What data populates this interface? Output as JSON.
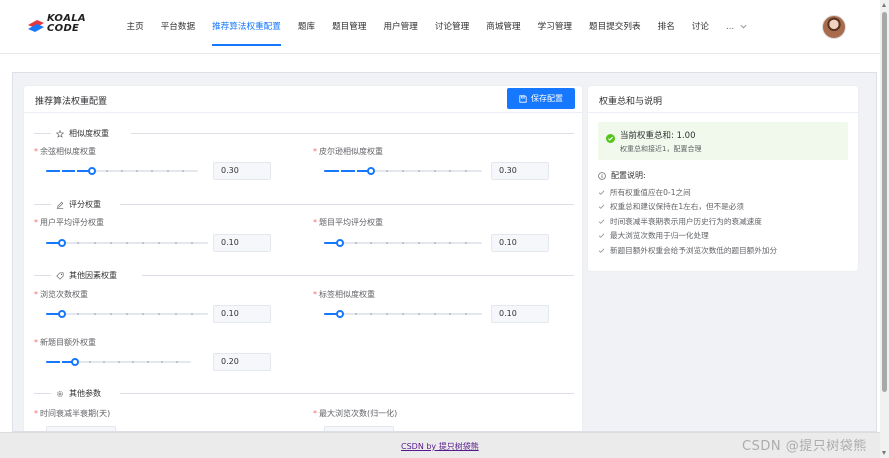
{
  "brand": {
    "logo_line1": "KOALA",
    "logo_line2": "CODE",
    "colors": {
      "red": "#e4393c",
      "blue": "#1677ff",
      "dark": "#1f1f1f"
    }
  },
  "nav": {
    "items": [
      {
        "label": "主页",
        "active": false
      },
      {
        "label": "平台数据",
        "active": false
      },
      {
        "label": "推荐算法权重配置",
        "active": true
      },
      {
        "label": "题库",
        "active": false
      },
      {
        "label": "题目管理",
        "active": false
      },
      {
        "label": "用户管理",
        "active": false
      },
      {
        "label": "讨论管理",
        "active": false
      },
      {
        "label": "商城管理",
        "active": false
      },
      {
        "label": "学习管理",
        "active": false
      },
      {
        "label": "题目提交列表",
        "active": false
      },
      {
        "label": "排名",
        "active": false
      },
      {
        "label": "讨论",
        "active": false
      }
    ],
    "more_label": "...",
    "more_icon": "chevron-down-icon"
  },
  "config_card": {
    "title": "推荐算法权重配置",
    "save_button": {
      "label": "保存配置",
      "icon": "save-icon"
    },
    "sections": [
      {
        "title": "相似度权重",
        "icon": "star-icon"
      },
      {
        "title": "评分权重",
        "icon": "edit-icon"
      },
      {
        "title": "其他因素权重",
        "icon": "tag-icon"
      },
      {
        "title": "其他参数",
        "icon": "settings-icon"
      }
    ],
    "fields": {
      "cosine": {
        "label": "余弦相似度权重",
        "value": "0.30",
        "level": 0.3
      },
      "pearson": {
        "label": "皮尔逊相似度权重",
        "value": "0.30",
        "level": 0.3
      },
      "user_rating": {
        "label": "用户平均评分权重",
        "value": "0.10",
        "level": 0.1
      },
      "problem_rating": {
        "label": "题目平均评分权重",
        "value": "0.10",
        "level": 0.1
      },
      "browse_count": {
        "label": "浏览次数权重",
        "value": "0.10",
        "level": 0.1
      },
      "tag_similarity": {
        "label": "标签相似度权重",
        "value": "0.10",
        "level": 0.1
      },
      "new_problem_bonus": {
        "label": "新题目额外权重",
        "value": "0.20",
        "level": 0.2
      },
      "time_decay": {
        "label": "时间衰减半衰期(天)"
      },
      "max_browse": {
        "label": "最大浏览次数(归一化)"
      }
    },
    "required_mark": "*"
  },
  "summary_card": {
    "title": "权重总和与说明",
    "status_icon": "check-circle-icon",
    "status_title": "当前权重总和: 1.00",
    "status_desc": "权重总和接近1，配置合理",
    "notes_title": "配置说明:",
    "notes_icon": "info-icon",
    "notes": [
      "所有权重值应在0-1之间",
      "权重总和建议保持在1左右，但不是必须",
      "时间衰减半衰期表示用户历史行为的衰减速度",
      "最大浏览次数用于归一化处理",
      "新题目额外权重会给予浏览次数低的题目额外加分"
    ]
  },
  "footer": {
    "link": "CSDN by 提只树袋熊"
  },
  "watermark": "CSDN @提只树袋熊"
}
